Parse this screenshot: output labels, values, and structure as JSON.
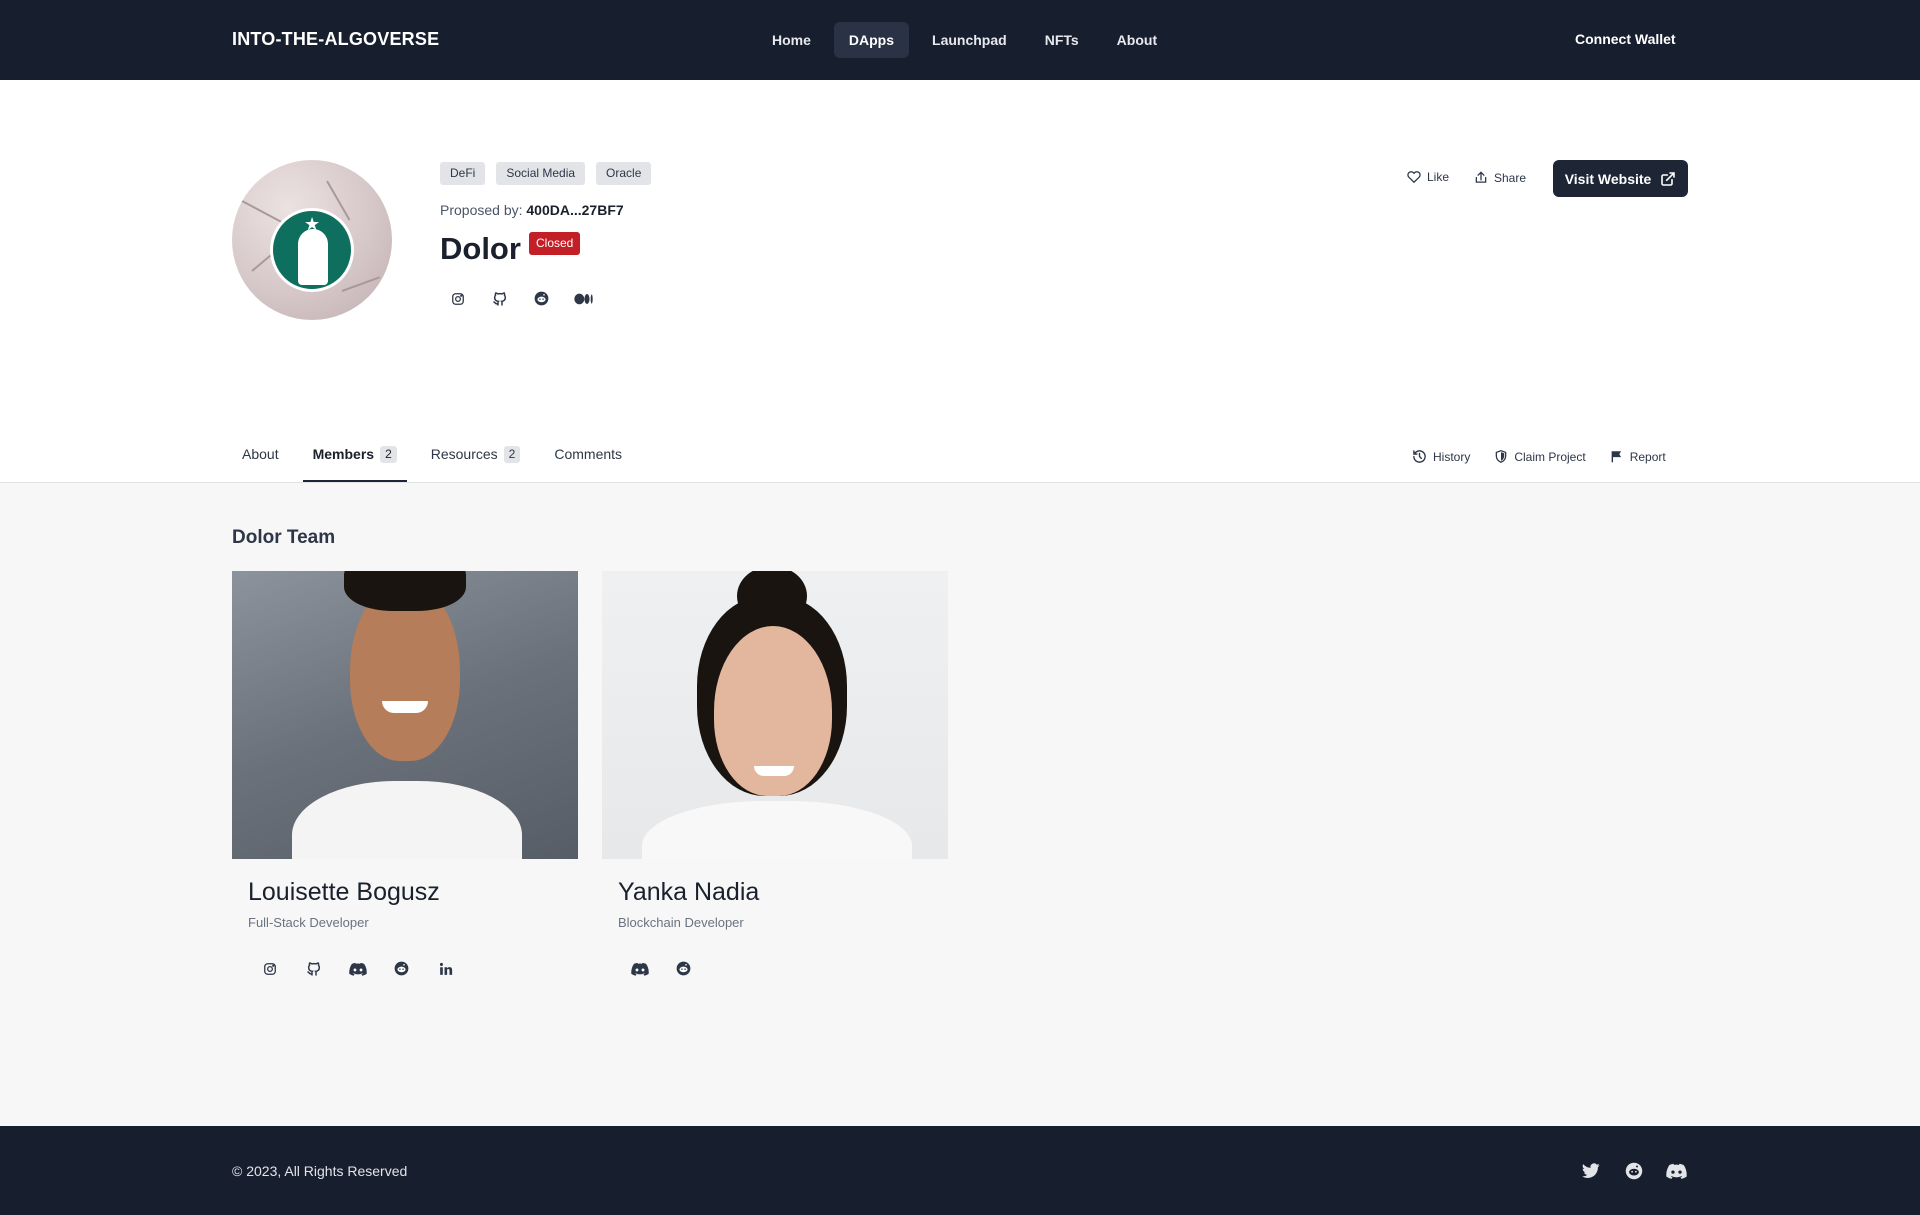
{
  "nav": {
    "brand": "INTO-THE-ALGOVERSE",
    "links": [
      "Home",
      "DApps",
      "Launchpad",
      "NFTs",
      "About"
    ],
    "active_link": "DApps",
    "connect_label": "Connect Wallet"
  },
  "project": {
    "tags": [
      "DeFi",
      "Social Media",
      "Oracle"
    ],
    "proposed_label": "Proposed by:",
    "proposed_by": "400DA...27BF7",
    "name": "Dolor",
    "status": "Closed",
    "socials": [
      "instagram-icon",
      "github-icon",
      "reddit-icon",
      "medium-icon"
    ]
  },
  "header_actions": {
    "like_label": "Like",
    "share_label": "Share",
    "visit_label": "Visit Website"
  },
  "tabs": [
    {
      "label": "About",
      "count": ""
    },
    {
      "label": "Members",
      "count": "2"
    },
    {
      "label": "Resources",
      "count": "2"
    },
    {
      "label": "Comments",
      "count": ""
    }
  ],
  "active_tab": "Members",
  "tab_actions": {
    "history_label": "History",
    "claim_label": "Claim Project",
    "report_label": "Report"
  },
  "team": {
    "title": "Dolor Team",
    "members": [
      {
        "name": "Louisette Bogusz",
        "role": "Full-Stack Developer",
        "links": [
          "instagram-icon",
          "github-icon",
          "discord-icon",
          "reddit-icon",
          "linkedin-icon"
        ]
      },
      {
        "name": "Yanka Nadia",
        "role": "Blockchain Developer",
        "links": [
          "discord-icon",
          "reddit-icon"
        ]
      }
    ]
  },
  "footer": {
    "copyright": "© 2023, All Rights Reserved",
    "socials": [
      "twitter-icon",
      "reddit-icon",
      "discord-icon"
    ]
  },
  "colors": {
    "nav_bg": "#171e2e",
    "status_closed": "#c21f27",
    "primary_button": "#1e2636",
    "content_bg": "#f7f7f7"
  }
}
